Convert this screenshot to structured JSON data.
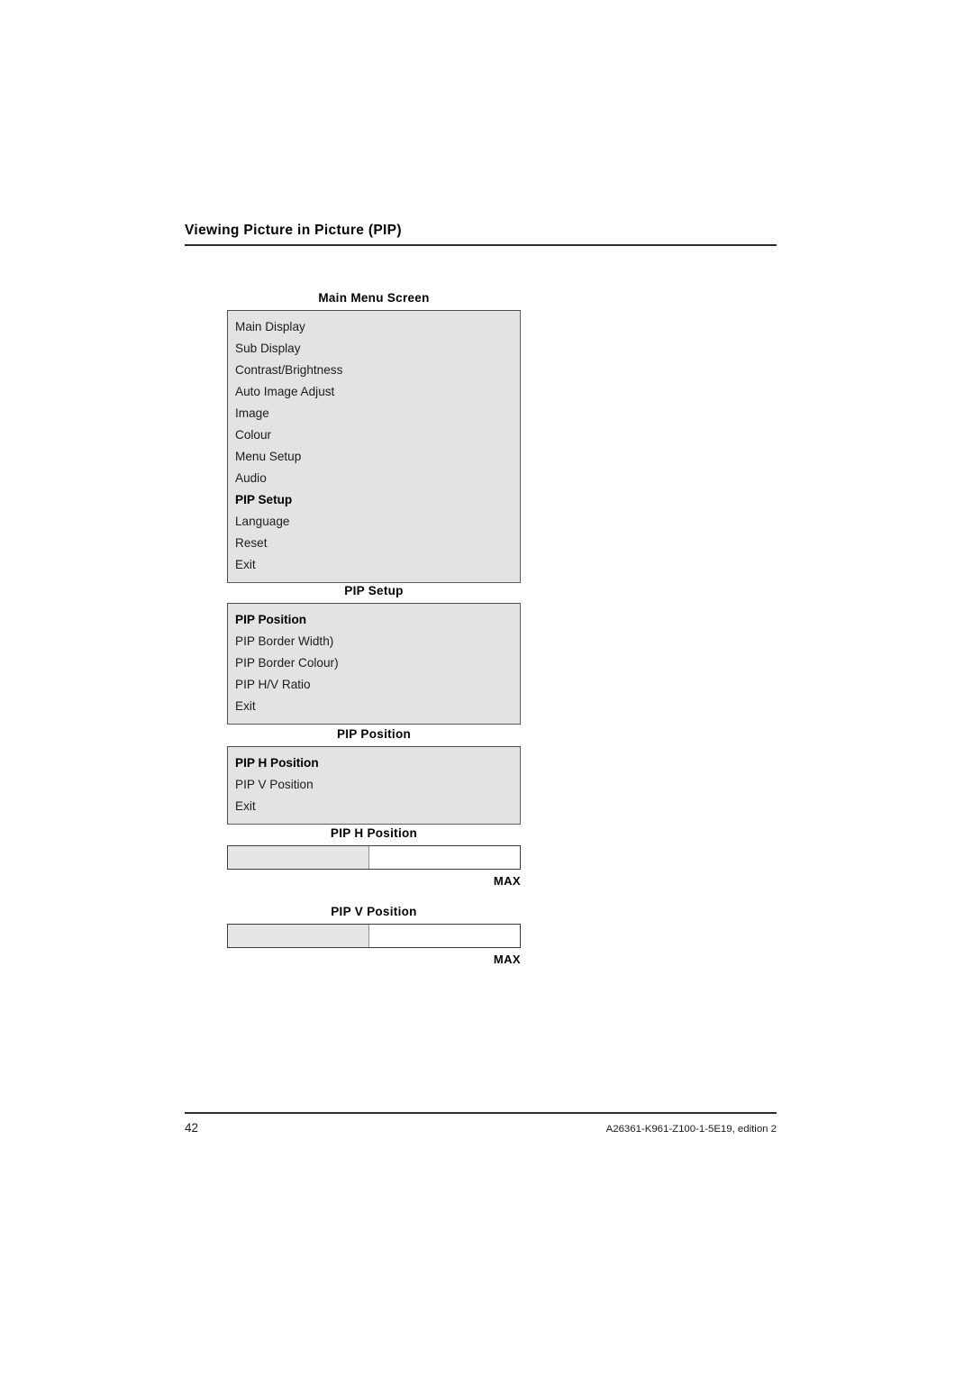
{
  "page": {
    "header_title": "Viewing Picture in Picture (PIP)",
    "number": "42",
    "document_id": "A26361-K961-Z100-1-5E19, edition 2"
  },
  "menus": [
    {
      "caption": "Main Menu Screen",
      "items": [
        {
          "label": "Main Display",
          "selected": false
        },
        {
          "label": "Sub Display",
          "selected": false
        },
        {
          "label": "Contrast/Brightness",
          "selected": false
        },
        {
          "label": "Auto Image Adjust",
          "selected": false
        },
        {
          "label": "Image",
          "selected": false
        },
        {
          "label": "Colour",
          "selected": false
        },
        {
          "label": "Menu Setup",
          "selected": false
        },
        {
          "label": "Audio",
          "selected": false
        },
        {
          "label": "PIP Setup",
          "selected": true
        },
        {
          "label": "Language",
          "selected": false
        },
        {
          "label": "Reset",
          "selected": false
        },
        {
          "label": "Exit",
          "selected": false
        }
      ]
    },
    {
      "caption": "PIP Setup",
      "items": [
        {
          "label": "PIP Position",
          "selected": true
        },
        {
          "label": "PIP Border Width)",
          "selected": false
        },
        {
          "label": "PIP Border Colour)",
          "selected": false
        },
        {
          "label": "PIP H/V Ratio",
          "selected": false
        },
        {
          "label": "Exit",
          "selected": false
        }
      ]
    },
    {
      "caption": "PIP Position",
      "items": [
        {
          "label": "PIP H Position",
          "selected": true
        },
        {
          "label": "PIP V Position",
          "selected": false
        },
        {
          "label": "Exit",
          "selected": false
        }
      ]
    }
  ],
  "sliders": [
    {
      "caption": "PIP H Position",
      "fill_percent": 48,
      "max_label": "MAX"
    },
    {
      "caption": "PIP V Position",
      "fill_percent": 48,
      "max_label": "MAX"
    }
  ]
}
